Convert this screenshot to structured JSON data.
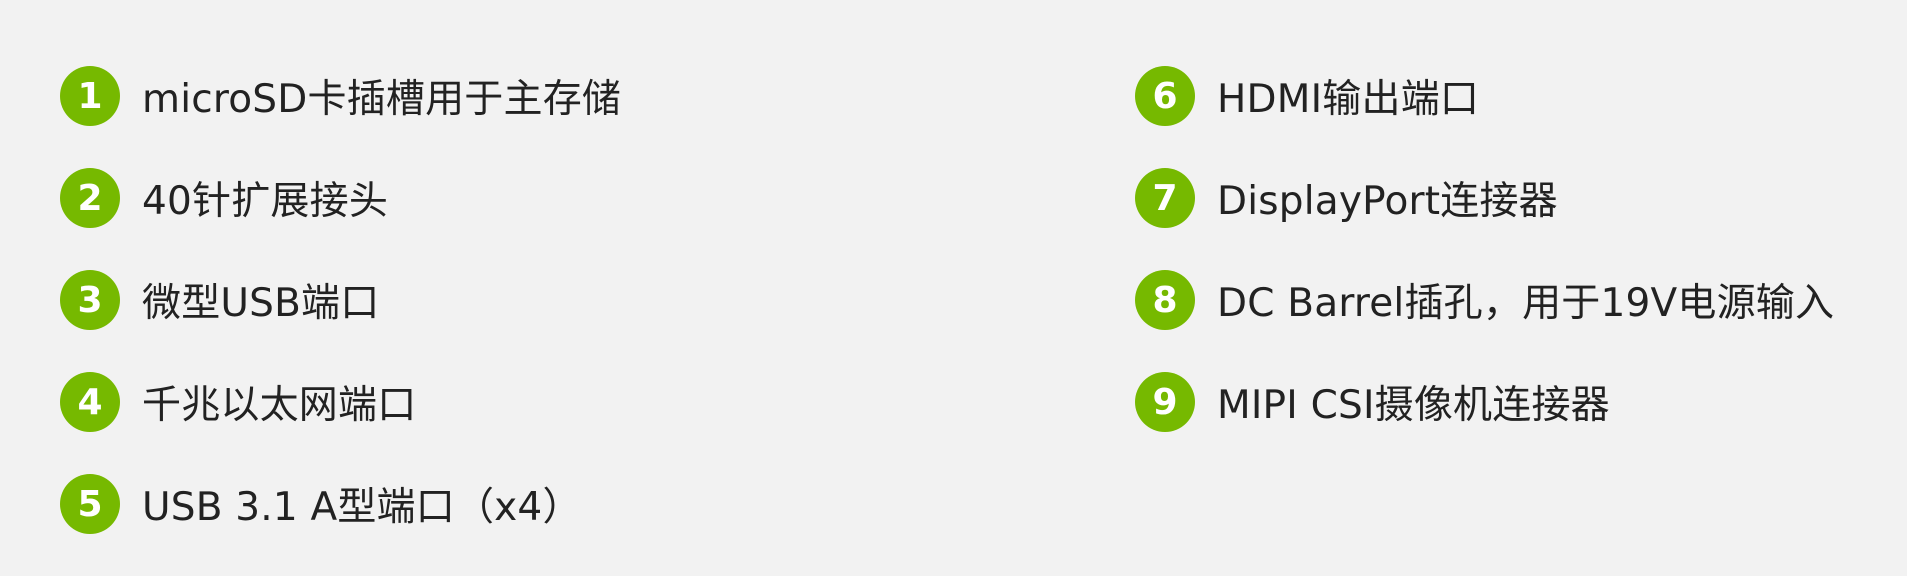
{
  "accent_color": "#76b900",
  "items_left": [
    {
      "number": "1",
      "label": "microSD卡插槽用于主存储"
    },
    {
      "number": "2",
      "label": "40针扩展接头"
    },
    {
      "number": "3",
      "label": "微型USB端口"
    },
    {
      "number": "4",
      "label": "千兆以太网端口"
    },
    {
      "number": "5",
      "label": "USB 3.1 A型端口（x4）"
    }
  ],
  "items_right": [
    {
      "number": "6",
      "label": "HDMI输出端口"
    },
    {
      "number": "7",
      "label": "DisplayPort连接器"
    },
    {
      "number": "8",
      "label": "DC Barrel插孔，用于19V电源输入"
    },
    {
      "number": "9",
      "label": "MIPI CSI摄像机连接器"
    }
  ]
}
